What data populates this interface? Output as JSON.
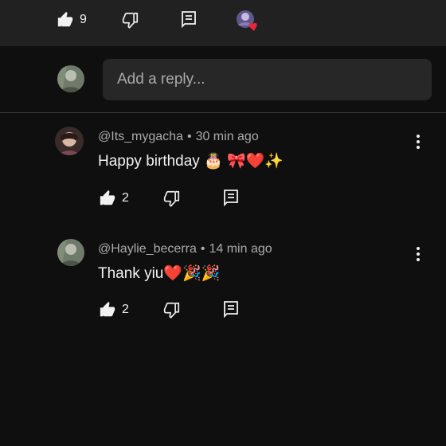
{
  "top_actions": {
    "like_count": "9"
  },
  "reply_box": {
    "placeholder": "Add a reply..."
  },
  "comments": [
    {
      "handle": "@Its_mygacha",
      "time": "30 min ago",
      "text": "Happy birthday 🎂 🎀❤️✨",
      "like_count": "2"
    },
    {
      "handle": "@Haylie_becerra",
      "time": "14 min ago",
      "text": "Thank yiu❤️🎉🎉",
      "like_count": "2"
    }
  ],
  "colors": {
    "background": "#0f0f0f",
    "top_bar": "#212121",
    "input_bg": "#272727",
    "heart": "#e8283a",
    "secondary_text": "#aaaaaa"
  }
}
